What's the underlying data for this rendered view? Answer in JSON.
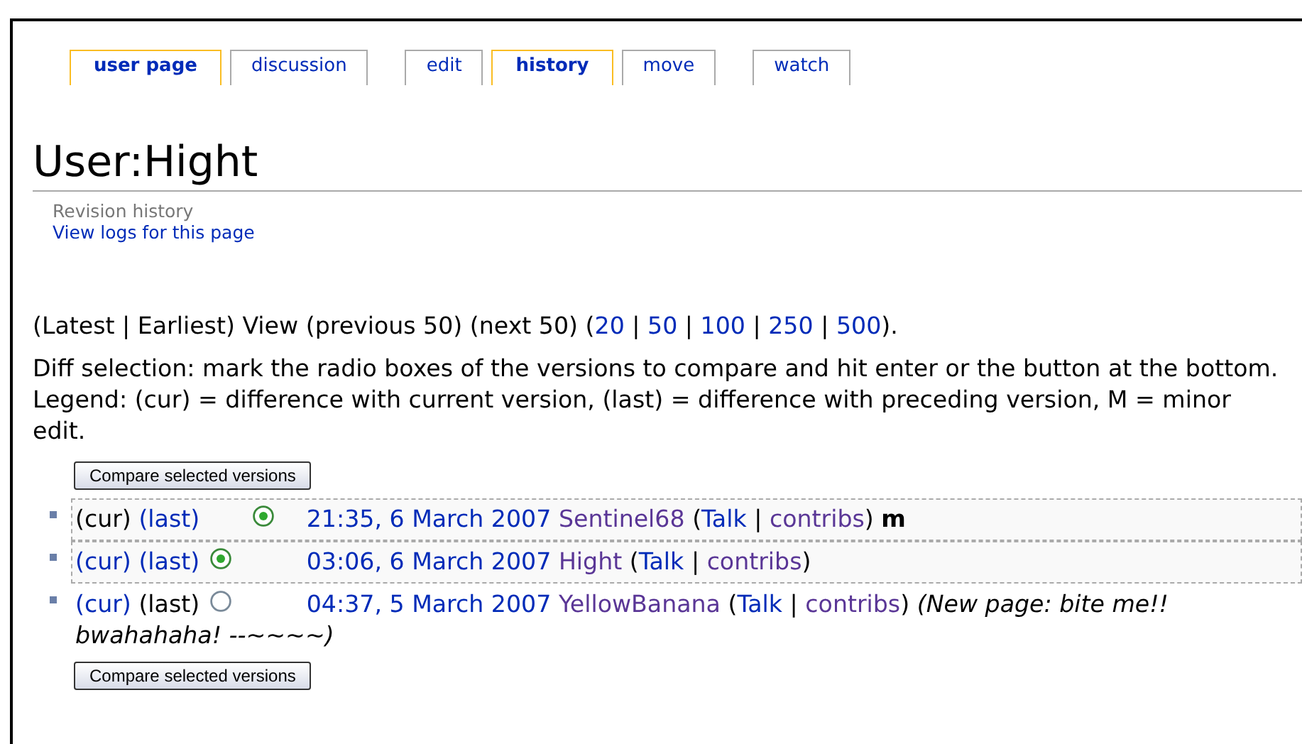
{
  "tab_groups": [
    [
      {
        "label": "user page",
        "selected": true
      },
      {
        "label": "discussion",
        "selected": false
      }
    ],
    [
      {
        "label": "edit",
        "selected": false
      },
      {
        "label": "history",
        "selected": true
      },
      {
        "label": "move",
        "selected": false
      }
    ],
    [
      {
        "label": "watch",
        "selected": false
      }
    ]
  ],
  "title": "User:Hight",
  "subtitle": "Revision history",
  "logs_link": "View logs for this page",
  "navigation": [
    {
      "text": "(Latest | Earliest) View (previous 50) (next 50) (",
      "kind": "plain"
    },
    {
      "text": "20",
      "kind": "link"
    },
    {
      "text": " | ",
      "kind": "plain"
    },
    {
      "text": "50",
      "kind": "link"
    },
    {
      "text": " | ",
      "kind": "plain"
    },
    {
      "text": "100",
      "kind": "link"
    },
    {
      "text": " | ",
      "kind": "plain"
    },
    {
      "text": "250",
      "kind": "link"
    },
    {
      "text": " | ",
      "kind": "plain"
    },
    {
      "text": "500",
      "kind": "link"
    },
    {
      "text": ").",
      "kind": "plain"
    }
  ],
  "instructions": "Diff selection: mark the radio boxes of the versions to compare and hit enter or the button at the bottom.",
  "legend": "Legend: (cur) = difference with current version, (last) = difference with preceding version, M = minor edit.",
  "compare_button": "Compare selected versions",
  "revisions": [
    {
      "highlighted": true,
      "cur": {
        "text": "(cur)",
        "kind": "plain"
      },
      "last": {
        "text": "(last)",
        "kind": "link"
      },
      "radio": {
        "kind": "diff",
        "selected": true
      },
      "entry": [
        {
          "text": "21:35, 6 March 2007",
          "kind": "link"
        },
        {
          "text": "Sentinel68",
          "kind": "visited"
        },
        {
          "text": "(",
          "kind": "plain"
        },
        {
          "text": "Talk",
          "kind": "link"
        },
        {
          "text": "|",
          "kind": "plain"
        },
        {
          "text": "contribs",
          "kind": "visited"
        },
        {
          "text": ")",
          "kind": "plain"
        },
        {
          "text": "m",
          "kind": "bold"
        }
      ]
    },
    {
      "highlighted": true,
      "cur": {
        "text": "(cur)",
        "kind": "link"
      },
      "last": {
        "text": "(last)",
        "kind": "link"
      },
      "radio": {
        "kind": "oldid",
        "selected": true
      },
      "entry": [
        {
          "text": "03:06, 6 March 2007",
          "kind": "link"
        },
        {
          "text": "Hight",
          "kind": "visited"
        },
        {
          "text": "(",
          "kind": "plain"
        },
        {
          "text": "Talk",
          "kind": "link"
        },
        {
          "text": "|",
          "kind": "plain"
        },
        {
          "text": "contribs",
          "kind": "visited"
        },
        {
          "text": ")",
          "kind": "plain"
        }
      ]
    },
    {
      "highlighted": false,
      "cur": {
        "text": "(cur)",
        "kind": "link"
      },
      "last": {
        "text": "(last)",
        "kind": "plain"
      },
      "radio": {
        "kind": "oldid",
        "selected": false
      },
      "entry": [
        {
          "text": "04:37, 5 March 2007",
          "kind": "link"
        },
        {
          "text": "YellowBanana",
          "kind": "visited"
        },
        {
          "text": "(",
          "kind": "plain"
        },
        {
          "text": "Talk",
          "kind": "link"
        },
        {
          "text": "|",
          "kind": "plain"
        },
        {
          "text": "contribs",
          "kind": "visited"
        },
        {
          "text": ")",
          "kind": "plain"
        },
        {
          "text": "(New page: bite me!!",
          "kind": "italic"
        },
        {
          "text": "bwahahaha! --~~~~)",
          "kind": "italic_line"
        }
      ]
    }
  ],
  "bottom_button": "Compare selected versions"
}
